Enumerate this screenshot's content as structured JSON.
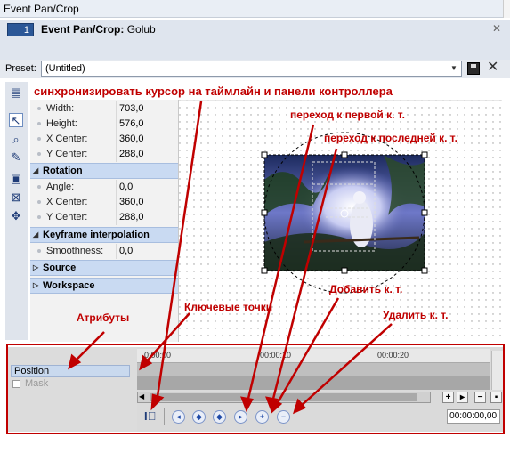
{
  "window": {
    "title": "Event Pan/Crop"
  },
  "header": {
    "track_number": "1",
    "title_bold": "Event Pan/Crop:",
    "title_rest": " Golub"
  },
  "preset": {
    "label": "Preset:",
    "value": "(Untitled)"
  },
  "properties": {
    "rows_top": [
      {
        "key": "Width:",
        "value": "703,0"
      },
      {
        "key": "Height:",
        "value": "576,0"
      },
      {
        "key": "X Center:",
        "value": "360,0"
      },
      {
        "key": "Y Center:",
        "value": "288,0"
      }
    ],
    "rotation": {
      "label": "Rotation",
      "rows": [
        {
          "key": "Angle:",
          "value": "0,0"
        },
        {
          "key": "X Center:",
          "value": "360,0"
        },
        {
          "key": "Y Center:",
          "value": "288,0"
        }
      ]
    },
    "keyframe_interpolation": {
      "label": "Keyframe interpolation",
      "rows": [
        {
          "key": "Smoothness:",
          "value": "0,0"
        }
      ]
    },
    "source": {
      "label": "Source"
    },
    "workspace": {
      "label": "Workspace"
    }
  },
  "timeline": {
    "tracks": {
      "position": "Position",
      "mask": "Mask"
    },
    "ruler_ticks": [
      "0:00:00",
      "00:00:10",
      "00:00:20"
    ],
    "timecode": "00:00:00,00"
  },
  "annotations": {
    "sync": "синхронизировать курсор на таймлайн и панели контроллера",
    "first_kf": "переход к первой к. т.",
    "last_kf": "переход к последней к. т.",
    "add_kf": "Добавить к. т.",
    "delete_kf": "Удалить к. т.",
    "attributes": "Атрибуты",
    "keyframes": "Ключевые точки"
  },
  "colors": {
    "annotation": "#c00000",
    "section_header": "#c9daf2",
    "accent": "#2b5797"
  },
  "icons": {
    "tools": [
      "properties-icon",
      "pointer-icon",
      "zoom-icon",
      "edit-icon",
      "fill-frame-icon",
      "crop-icon",
      "move-icon"
    ],
    "keyframe_nav": [
      "first-keyframe-icon",
      "prev-keyframe-icon",
      "next-keyframe-icon",
      "last-keyframe-icon",
      "add-keyframe-icon",
      "delete-keyframe-icon"
    ]
  }
}
